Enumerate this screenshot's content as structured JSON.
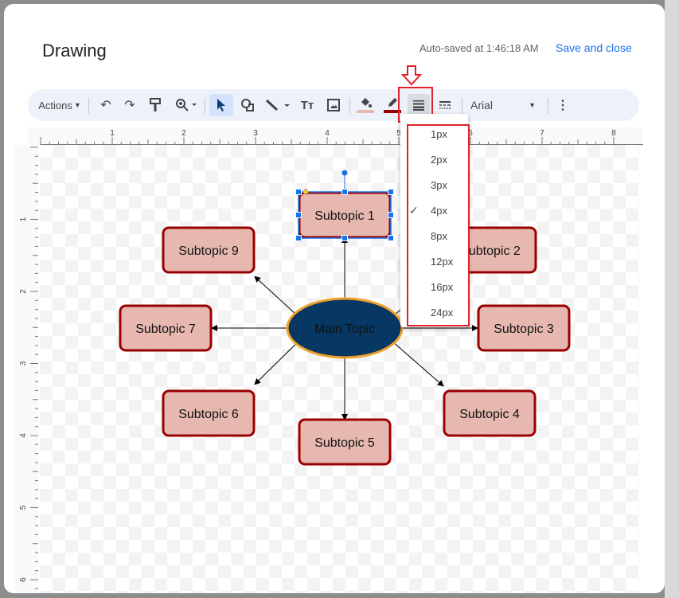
{
  "dialog": {
    "title": "Drawing",
    "autosave": "Auto-saved at 1:46:18 AM",
    "save_close": "Save and close"
  },
  "toolbar": {
    "actions": "Actions",
    "font": "Arial",
    "icons": [
      "undo-icon",
      "redo-icon",
      "paint-format-icon",
      "zoom-icon",
      "select-icon",
      "shape-icon",
      "line-icon",
      "text-box-icon",
      "image-icon",
      "fill-color-icon",
      "border-color-icon",
      "border-weight-icon",
      "border-dash-icon",
      "more-icon"
    ],
    "fill_color": "#e6b8af",
    "border_color": "#990000"
  },
  "ruler": {
    "top": [
      "1",
      "2",
      "3",
      "4",
      "5",
      "6",
      "7",
      "8"
    ],
    "left": [
      "1",
      "2",
      "3",
      "4",
      "5",
      "6"
    ]
  },
  "diagram": {
    "main": "Main Topic",
    "main_fill": "#073763",
    "main_border": "#f1a02a",
    "box_fill": "#e6b8af",
    "box_border": "#990000",
    "subtopics": [
      "Subtopic 1",
      "Subtopic 2",
      "Subtopic 3",
      "Subtopic 4",
      "Subtopic 5",
      "Subtopic 6",
      "Subtopic 7",
      "Subtopic 9"
    ],
    "selected": "Subtopic 1"
  },
  "border_weight_menu": {
    "items": [
      "1px",
      "2px",
      "3px",
      "4px",
      "8px",
      "12px",
      "16px",
      "24px"
    ],
    "selected": "4px"
  },
  "annotation_color": "#e0202a"
}
